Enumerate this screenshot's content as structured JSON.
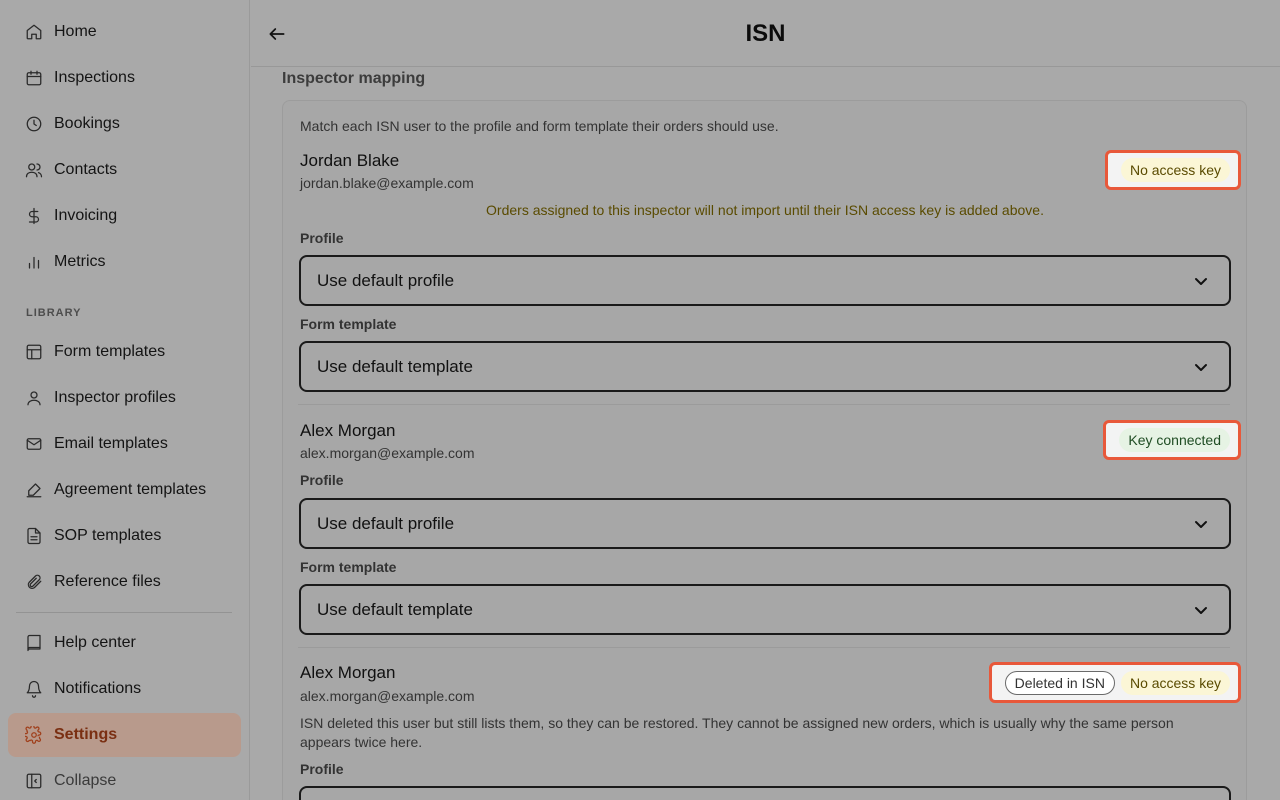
{
  "sidebar": {
    "items": [
      {
        "label": "Home",
        "icon": "home-icon"
      },
      {
        "label": "Inspections",
        "icon": "calendar-icon"
      },
      {
        "label": "Bookings",
        "icon": "clock-icon"
      },
      {
        "label": "Contacts",
        "icon": "users-icon"
      },
      {
        "label": "Invoicing",
        "icon": "dollar-icon"
      },
      {
        "label": "Metrics",
        "icon": "bar-chart-icon"
      }
    ],
    "library_label": "LIBRARY",
    "library_items": [
      {
        "label": "Form templates",
        "icon": "layout-icon"
      },
      {
        "label": "Inspector profiles",
        "icon": "user-icon"
      },
      {
        "label": "Email templates",
        "icon": "mail-icon"
      },
      {
        "label": "Agreement templates",
        "icon": "signature-icon"
      },
      {
        "label": "SOP templates",
        "icon": "file-text-icon"
      },
      {
        "label": "Reference files",
        "icon": "paperclip-icon"
      }
    ],
    "bottom_items": [
      {
        "label": "Help center",
        "icon": "book-icon"
      },
      {
        "label": "Notifications",
        "icon": "bell-icon"
      },
      {
        "label": "Settings",
        "icon": "gear-icon",
        "active": true
      },
      {
        "label": "Collapse",
        "icon": "sidebar-collapse-icon"
      }
    ]
  },
  "header": {
    "title": "ISN"
  },
  "main": {
    "section_title": "Inspector mapping",
    "intro": "Match each ISN user to the profile and form template their orders should use.",
    "profile_label": "Profile",
    "form_template_label": "Form template",
    "users": [
      {
        "name": "Jordan Blake",
        "email": "jordan.blake@example.com",
        "badges": [
          "No access key"
        ],
        "warning": "Orders assigned to this inspector will not import until their ISN access key is added above.",
        "profile": "Use default profile",
        "template": "Use default template"
      },
      {
        "name": "Alex Morgan",
        "email": "alex.morgan@example.com",
        "badges": [
          "Key connected"
        ],
        "profile": "Use default profile",
        "template": "Use default template"
      },
      {
        "name": "Alex Morgan",
        "email": "alex.morgan@example.com",
        "badges": [
          "Deleted in ISN",
          "No access key"
        ],
        "note": "ISN deleted this user but still lists them, so they can be restored. They cannot be assigned new orders, which is usually why the same person appears twice here."
      }
    ]
  },
  "colors": {
    "accent": "#a0401c",
    "highlight": "#e8583a",
    "warning_text": "#5a4b00",
    "success_text": "#1f4d23"
  }
}
